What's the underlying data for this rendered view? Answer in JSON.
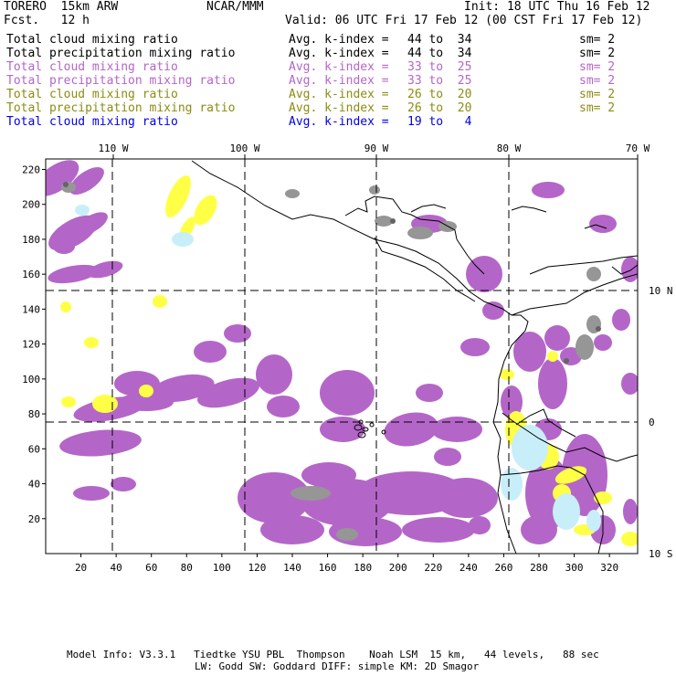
{
  "header": {
    "model": "TORERO  15km ARW",
    "org": "NCAR/MMM",
    "init": "Init: 18 UTC Thu 16 Feb 12",
    "fcst": "Fcst.   12 h",
    "valid": "Valid: 06 UTC Fri 17 Feb 12 (00 CST Fri 17 Feb 12)"
  },
  "legend": [
    {
      "field": "Total cloud mixing ratio",
      "index": "Avg. k-index =",
      "range": "44 to  34",
      "sm": "sm= 2",
      "color": "#000000"
    },
    {
      "field": "Total precipitation mixing ratio",
      "index": "Avg. k-index =",
      "range": "44 to  34",
      "sm": "sm= 2",
      "color": "#000000"
    },
    {
      "field": "Total cloud mixing ratio",
      "index": "Avg. k-index =",
      "range": "33 to  25",
      "sm": "sm= 2",
      "color": "#b466c8"
    },
    {
      "field": "Total precipitation mixing ratio",
      "index": "Avg. k-index =",
      "range": "33 to  25",
      "sm": "sm= 2",
      "color": "#b466c8"
    },
    {
      "field": "Total cloud mixing ratio",
      "index": "Avg. k-index =",
      "range": "26 to  20",
      "sm": "sm= 2",
      "color": "#8c8c14"
    },
    {
      "field": "Total precipitation mixing ratio",
      "index": "Avg. k-index =",
      "range": "26 to  20",
      "sm": "sm= 2",
      "color": "#8c8c14"
    },
    {
      "field": "Total cloud mixing ratio",
      "index": "Avg. k-index =",
      "range": "19 to   4",
      "sm": "",
      "color": "#0000e6"
    }
  ],
  "map": {
    "lon_labels": [
      "110 W",
      "100 W",
      "90 W",
      "80 W",
      "70 W"
    ],
    "lat_labels": [
      "10 N",
      "0",
      "10 S"
    ],
    "x_ticks": [
      20,
      40,
      60,
      80,
      100,
      120,
      140,
      160,
      180,
      200,
      220,
      240,
      260,
      280,
      300,
      320
    ],
    "y_ticks": [
      20,
      40,
      60,
      80,
      100,
      120,
      140,
      160,
      180,
      200,
      220
    ],
    "colors": {
      "purple": "#b466c8",
      "gray": "#969696",
      "dark_gray": "#646464",
      "yellow": "#ffff46",
      "light_blue": "#c8eefa",
      "coast": "#000000"
    }
  },
  "footer": {
    "line1": "Model Info: V3.3.1   Tiedtke YSU PBL  Thompson    Noah LSM  15 km,   44 levels,   88 sec",
    "line2": "LW: Godd SW: Goddard DIFF: simple KM: 2D Smagor"
  }
}
